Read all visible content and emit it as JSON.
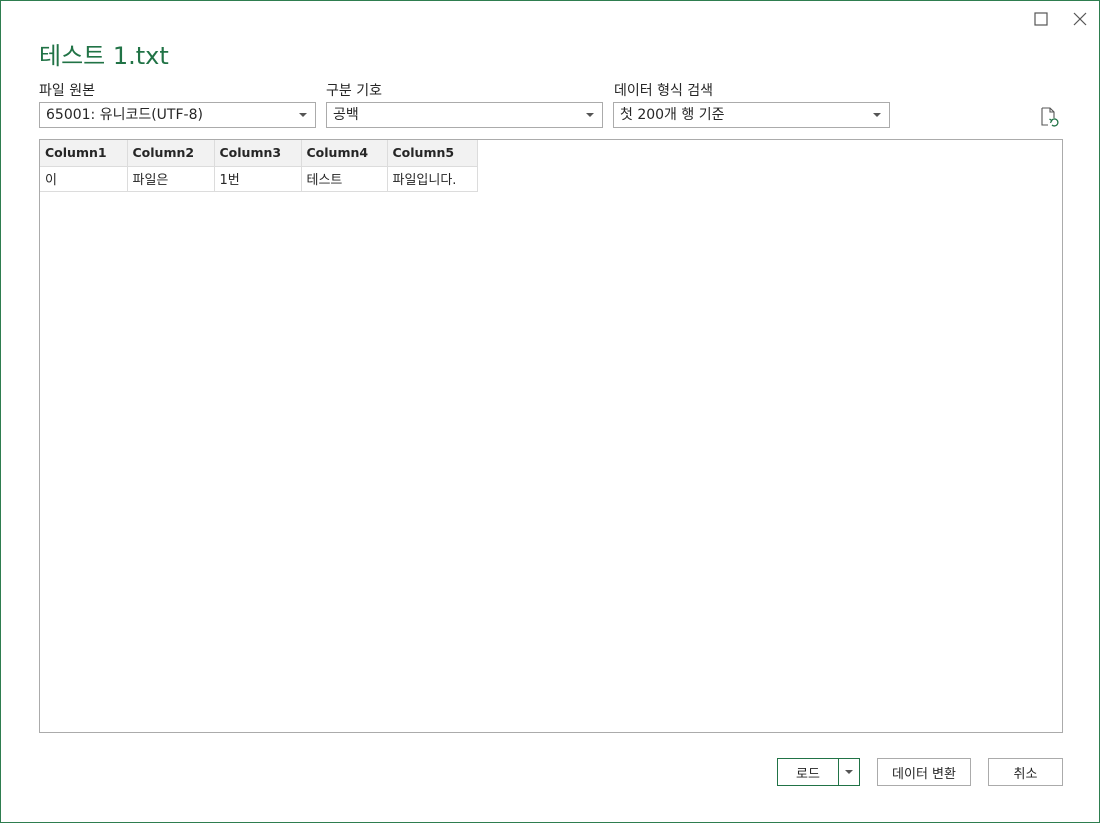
{
  "window": {
    "title": "테스트 1.txt"
  },
  "options": {
    "origin_label": "파일 원본",
    "origin_value": "65001: 유니코드(UTF-8)",
    "delimiter_label": "구분 기호",
    "delimiter_value": "공백",
    "detection_label": "데이터 형식 검색",
    "detection_value": "첫 200개 행 기준"
  },
  "table": {
    "columns": [
      "Column1",
      "Column2",
      "Column3",
      "Column4",
      "Column5"
    ],
    "rows": [
      [
        "이",
        "파일은",
        "1번",
        "테스트",
        "파일입니다."
      ]
    ]
  },
  "buttons": {
    "load": "로드",
    "transform": "데이터 변환",
    "cancel": "취소"
  },
  "icons": {
    "maximize": "maximize-icon",
    "close": "close-icon",
    "refresh": "refresh-file-icon",
    "dropdown": "chevron-down-icon"
  },
  "colors": {
    "accent": "#217346",
    "border": "#ababab"
  }
}
